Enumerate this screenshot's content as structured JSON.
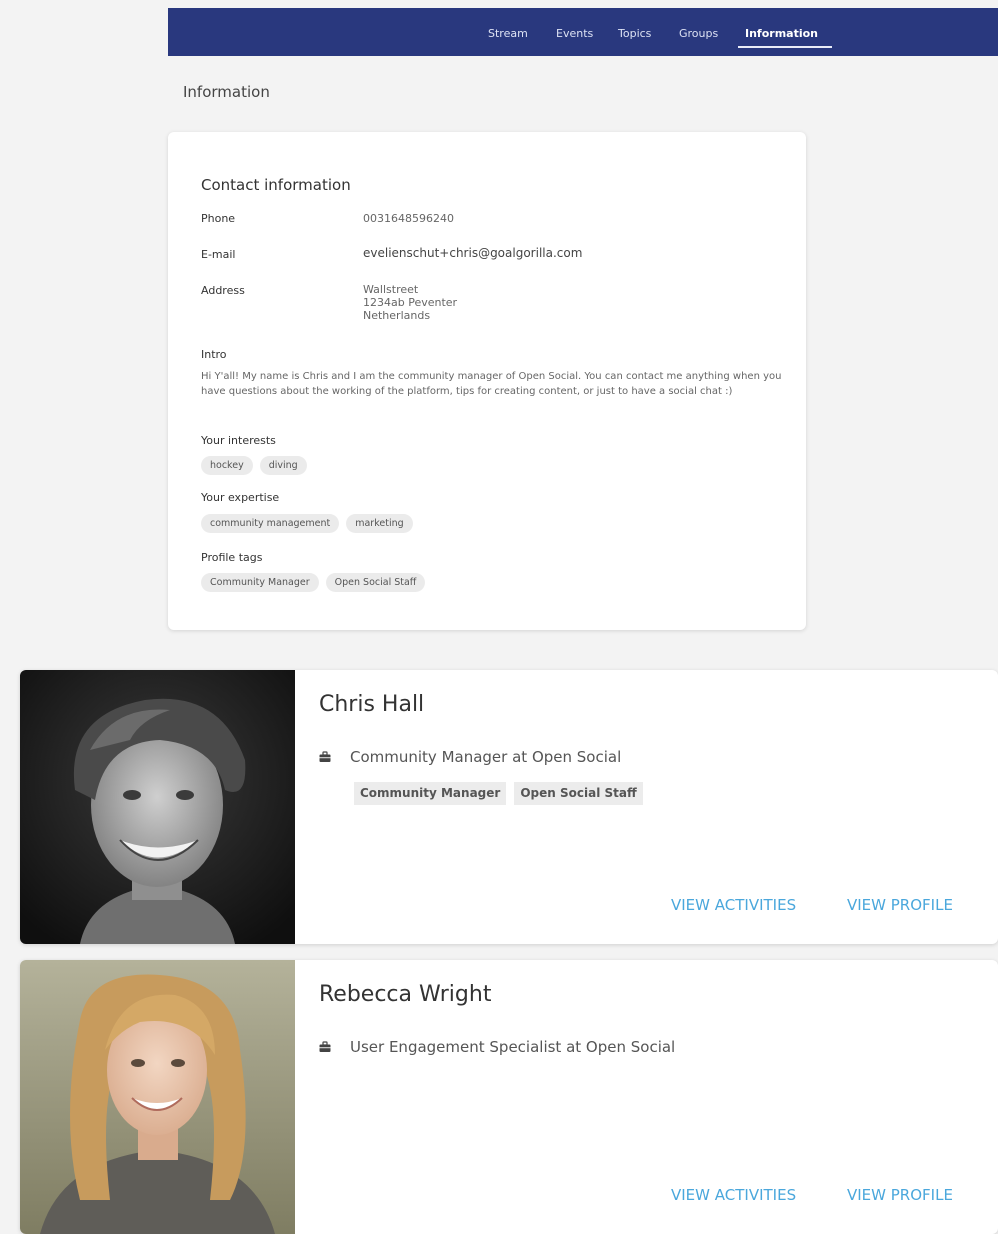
{
  "nav": {
    "items": [
      "Stream",
      "Events",
      "Topics",
      "Groups",
      "Information"
    ],
    "active": "Information"
  },
  "page_title": "Information",
  "contact": {
    "heading": "Contact information",
    "phone_label": "Phone",
    "phone": "0031648596240",
    "email_label": "E-mail",
    "email": "evelienschut+chris@goalgorilla.com",
    "address_label": "Address",
    "address_lines": [
      "Wallstreet",
      "1234ab Peventer",
      "Netherlands"
    ],
    "intro_label": "Intro",
    "intro": "Hi Y'all! My name is Chris and I am the community manager of Open Social. You can contact me anything when you have questions about the working of the platform, tips for creating content, or just to have a social chat :)",
    "interests_label": "Your interests",
    "interests": [
      "hockey",
      "diving"
    ],
    "expertise_label": "Your expertise",
    "expertise": [
      "community management",
      "marketing"
    ],
    "tags_label": "Profile tags",
    "tags": [
      "Community Manager",
      "Open Social Staff"
    ]
  },
  "profiles": [
    {
      "name": "Chris Hall",
      "role": "Community Manager at Open Social",
      "tags": [
        "Community Manager",
        "Open Social Staff"
      ],
      "view_activities": "VIEW ACTIVITIES",
      "view_profile": "VIEW PROFILE"
    },
    {
      "name": "Rebecca Wright",
      "role": "User Engagement Specialist at Open Social",
      "tags": [],
      "view_activities": "VIEW ACTIVITIES",
      "view_profile": "VIEW PROFILE"
    }
  ],
  "colors": {
    "navbar": "#29387e",
    "link": "#4aa7dc",
    "background": "#f3f3f3"
  }
}
